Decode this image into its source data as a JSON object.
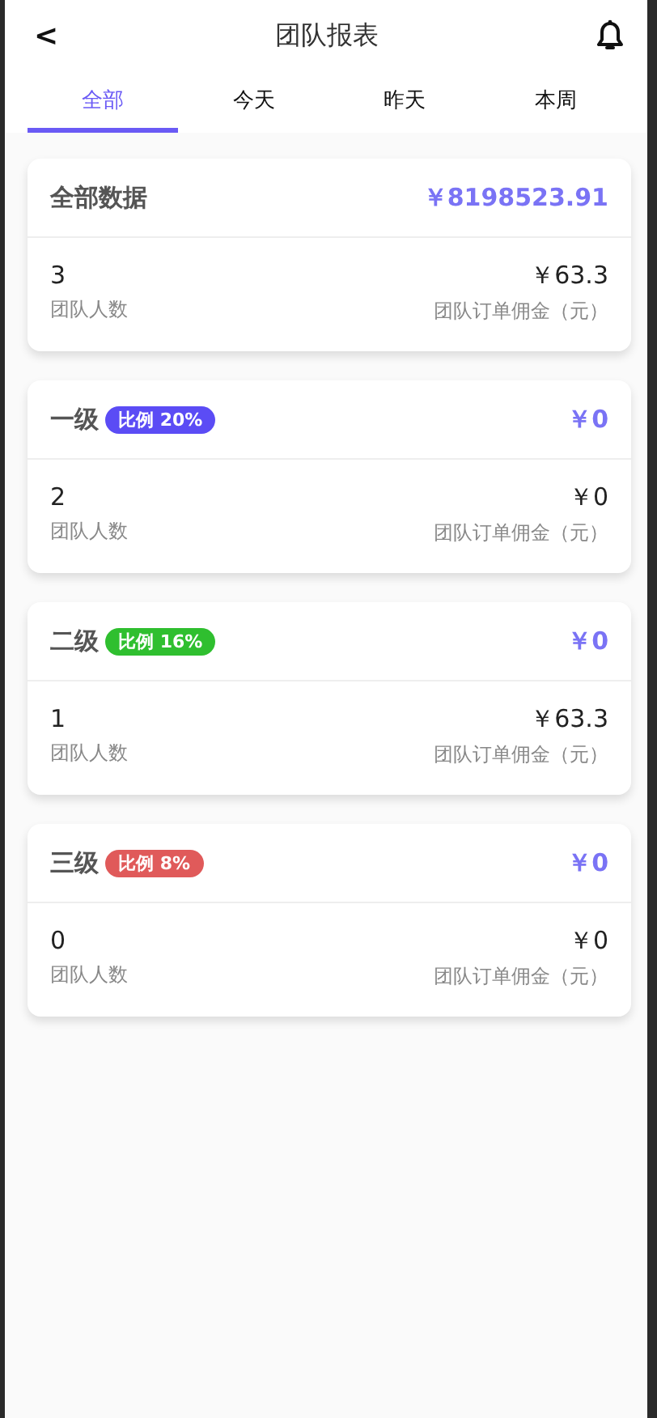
{
  "header": {
    "back": "<",
    "title": "团队报表"
  },
  "tabs": [
    {
      "label": "全部",
      "selected": true
    },
    {
      "label": "今天",
      "selected": false
    },
    {
      "label": "昨天",
      "selected": false
    },
    {
      "label": "本周",
      "selected": false
    }
  ],
  "cards": [
    {
      "title": "全部数据",
      "total": "￥8198523.91",
      "members": "3",
      "members_label": "团队人数",
      "commission": "￥63.3",
      "commission_label": "团队订单佣金（元）"
    },
    {
      "title": "一级",
      "badge": {
        "text": "比例 20%",
        "color": "#5b4cf5"
      },
      "total": "￥0",
      "members": "2",
      "members_label": "团队人数",
      "commission": "￥0",
      "commission_label": "团队订单佣金（元）"
    },
    {
      "title": "二级",
      "badge": {
        "text": "比例 16%",
        "color": "#2fbf2f"
      },
      "total": "￥0",
      "members": "1",
      "members_label": "团队人数",
      "commission": "￥63.3",
      "commission_label": "团队订单佣金（元）"
    },
    {
      "title": "三级",
      "badge": {
        "text": "比例 8%",
        "color": "#e05a5a"
      },
      "total": "￥0",
      "members": "0",
      "members_label": "团队人数",
      "commission": "￥0",
      "commission_label": "团队订单佣金（元）"
    }
  ]
}
